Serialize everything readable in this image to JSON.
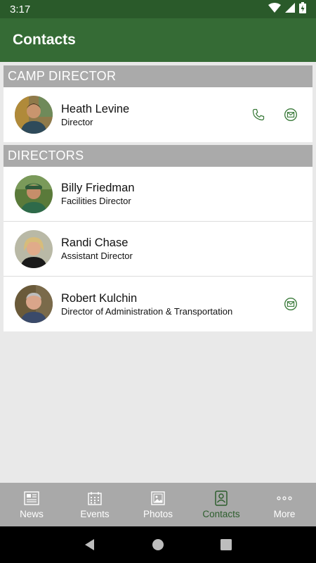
{
  "status_bar": {
    "time": "3:17"
  },
  "app_bar": {
    "title": "Contacts"
  },
  "sections": [
    {
      "header": "CAMP DIRECTOR",
      "contacts": [
        {
          "name": "Heath Levine",
          "role": "Director",
          "has_phone": true,
          "has_email": true
        }
      ]
    },
    {
      "header": "DIRECTORS",
      "contacts": [
        {
          "name": "Billy Friedman",
          "role": "Facilities Director",
          "has_phone": false,
          "has_email": false
        },
        {
          "name": "Randi Chase",
          "role": "Assistant Director",
          "has_phone": false,
          "has_email": false
        },
        {
          "name": "Robert Kulchin",
          "role": "Director of Administration & Transportation",
          "has_phone": false,
          "has_email": true
        }
      ]
    }
  ],
  "tab_bar": {
    "tabs": [
      {
        "label": "News",
        "icon": "newspaper-icon"
      },
      {
        "label": "Events",
        "icon": "calendar-icon"
      },
      {
        "label": "Photos",
        "icon": "photo-icon"
      },
      {
        "label": "Contacts",
        "icon": "contact-card-icon"
      },
      {
        "label": "More",
        "icon": "more-dots-icon"
      }
    ],
    "active": "Contacts"
  },
  "colors": {
    "app_bar": "#356b35",
    "status_bar": "#2a5a2a",
    "section_header": "#aaaaaa",
    "accent": "#2d5e2d",
    "tab_bar": "#a9a9a9"
  }
}
